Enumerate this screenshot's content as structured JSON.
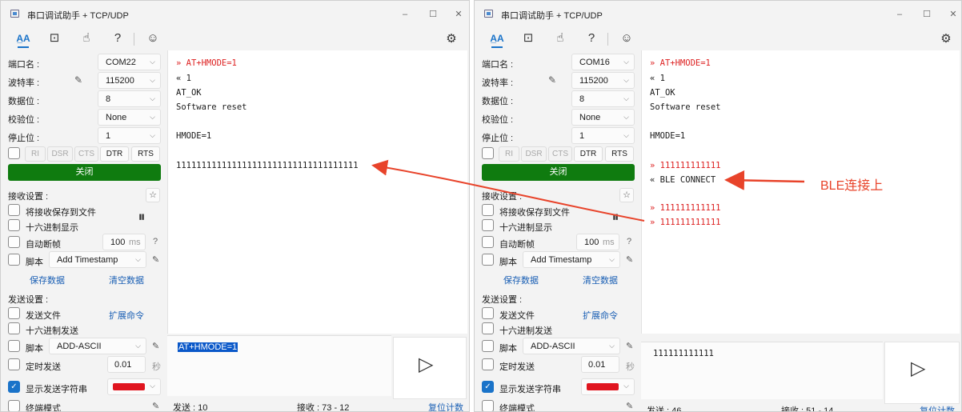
{
  "left_window": {
    "title": "串口调试助手 + TCP/UDP",
    "toolbar": {
      "icon1": "font-icon",
      "icon2": "wave-icon",
      "icon3": "hand-icon",
      "icon4": "help-icon",
      "icon5": "smile-icon"
    },
    "port_label": "端口名 :",
    "port_value": "COM22",
    "baud_label": "波特率 :",
    "baud_value": "115200",
    "databits_label": "数据位 :",
    "databits_value": "8",
    "parity_label": "校验位 :",
    "parity_value": "None",
    "stopbits_label": "停止位 :",
    "stopbits_value": "1",
    "signals": [
      "RI",
      "DSR",
      "CTS",
      "DTR",
      "RTS"
    ],
    "close_button": "关闭",
    "recv_settings": "接收设置 :",
    "save_to_file": "将接收保存到文件",
    "hex_display": "十六进制显示",
    "auto_frame": "自动断帧",
    "auto_frame_value": "100",
    "auto_frame_unit": "ms",
    "auto_frame_q": "?",
    "script": "脚本",
    "script_value": "Add Timestamp",
    "save_data": "保存数据",
    "clear_data": "清空数据",
    "send_settings": "发送设置 :",
    "send_file": "发送文件",
    "ext_cmd": "扩展命令",
    "hex_send": "十六进制发送",
    "send_script": "脚本",
    "send_script_value": "ADD-ASCII",
    "timed_send": "定时发送",
    "timed_value": "0.01",
    "timed_unit": "秒",
    "show_send": "显示发送字符串",
    "terminal_mode": "终端模式",
    "pause_glyph": "⏸",
    "log": [
      {
        "text": "» AT+HMODE=1",
        "color": "red"
      },
      {
        "text": "« 1",
        "color": "black"
      },
      {
        "text": "AT_OK",
        "color": "black"
      },
      {
        "text": "Software reset",
        "color": "black"
      },
      {
        "text": "",
        "color": "black"
      },
      {
        "text": "HMODE=1",
        "color": "black"
      },
      {
        "text": "",
        "color": "black"
      },
      {
        "text": "111111111111111111111111111111111111",
        "color": "black"
      }
    ],
    "send_text": "AT+HMODE=1",
    "status_sent": "发送 : 10",
    "status_recv": "接收 : 73  -  12",
    "reset_count": "复位计数"
  },
  "right_window": {
    "title": "串口调试助手 + TCP/UDP",
    "port_label": "端口名 :",
    "port_value": "COM16",
    "baud_label": "波特率 :",
    "baud_value": "115200",
    "databits_label": "数据位 :",
    "databits_value": "8",
    "parity_label": "校验位 :",
    "parity_value": "None",
    "stopbits_label": "停止位 :",
    "stopbits_value": "1",
    "signals": [
      "RI",
      "DSR",
      "CTS",
      "DTR",
      "RTS"
    ],
    "close_button": "关闭",
    "recv_settings": "接收设置 :",
    "save_to_file": "将接收保存到文件",
    "hex_display": "十六进制显示",
    "auto_frame": "自动断帧",
    "auto_frame_value": "100",
    "auto_frame_unit": "ms",
    "auto_frame_q": "?",
    "script": "脚本",
    "script_value": "Add Timestamp",
    "save_data": "保存数据",
    "clear_data": "清空数据",
    "send_settings": "发送设置 :",
    "send_file": "发送文件",
    "ext_cmd": "扩展命令",
    "hex_send": "十六进制发送",
    "send_script": "脚本",
    "send_script_value": "ADD-ASCII",
    "timed_send": "定时发送",
    "timed_value": "0.01",
    "timed_unit": "秒",
    "show_send": "显示发送字符串",
    "terminal_mode": "终端模式",
    "pause_glyph": "⏸",
    "log": [
      {
        "text": "» AT+HMODE=1",
        "color": "red"
      },
      {
        "text": "« 1",
        "color": "black"
      },
      {
        "text": "AT_OK",
        "color": "black"
      },
      {
        "text": "Software reset",
        "color": "black"
      },
      {
        "text": "",
        "color": "black"
      },
      {
        "text": "HMODE=1",
        "color": "black"
      },
      {
        "text": "",
        "color": "black"
      },
      {
        "text": "» 111111111111",
        "color": "red"
      },
      {
        "text": "« BLE CONNECT",
        "color": "black"
      },
      {
        "text": "",
        "color": "black"
      },
      {
        "text": "» 111111111111",
        "color": "red"
      },
      {
        "text": "» 111111111111",
        "color": "red"
      }
    ],
    "send_text": "111111111111",
    "status_sent": "发送 : 46",
    "status_recv": "接收 : 51  -  14",
    "reset_count": "复位计数"
  },
  "annotation": "BLE连接上",
  "colors": {
    "accent": "#1a73c9",
    "green": "#0f7b0f",
    "red_log": "#dd2222",
    "annotation": "#e8432a",
    "send_color_swatch": "#e0151f"
  }
}
